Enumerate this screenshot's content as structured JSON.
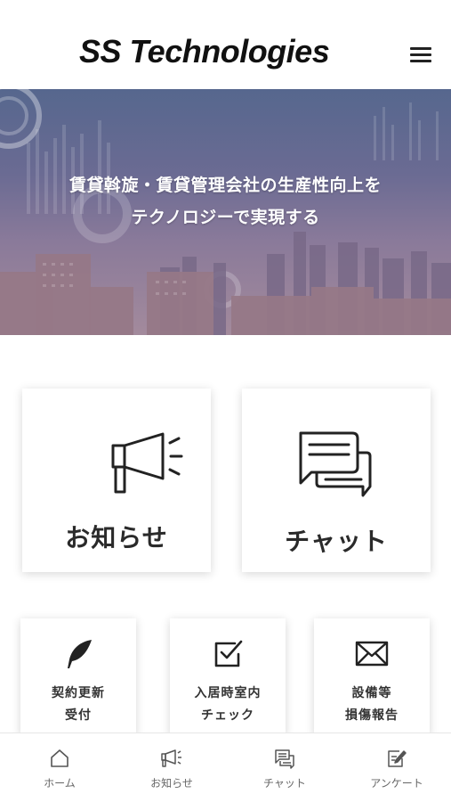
{
  "header": {
    "logo_text": "SS Technologies",
    "menu_icon": "hamburger-menu-icon"
  },
  "hero": {
    "line1": "賃貸斡旋・賃貸管理会社の生産性向上を",
    "line2": "テクノロジーで実現する"
  },
  "main_cards": [
    {
      "label": "お知らせ",
      "icon": "megaphone-icon"
    },
    {
      "label": "チャット",
      "icon": "chat-bubbles-icon"
    }
  ],
  "sub_cards": [
    {
      "label": "契約更新\n受付",
      "icon": "feather-pen-icon"
    },
    {
      "label": "入居時室内\nチェック",
      "icon": "checkbox-icon"
    },
    {
      "label": "設備等\n損傷報告",
      "icon": "envelope-icon"
    }
  ],
  "bottom_nav": [
    {
      "label": "ホーム",
      "icon": "home-icon"
    },
    {
      "label": "お知らせ",
      "icon": "megaphone-icon"
    },
    {
      "label": "チャット",
      "icon": "chat-bubbles-icon"
    },
    {
      "label": "アンケート",
      "icon": "survey-edit-icon"
    }
  ],
  "colors": {
    "hero_top": "#56678e",
    "hero_bottom": "#a38a9c",
    "text_dark": "#222222",
    "nav_text": "#666666"
  }
}
